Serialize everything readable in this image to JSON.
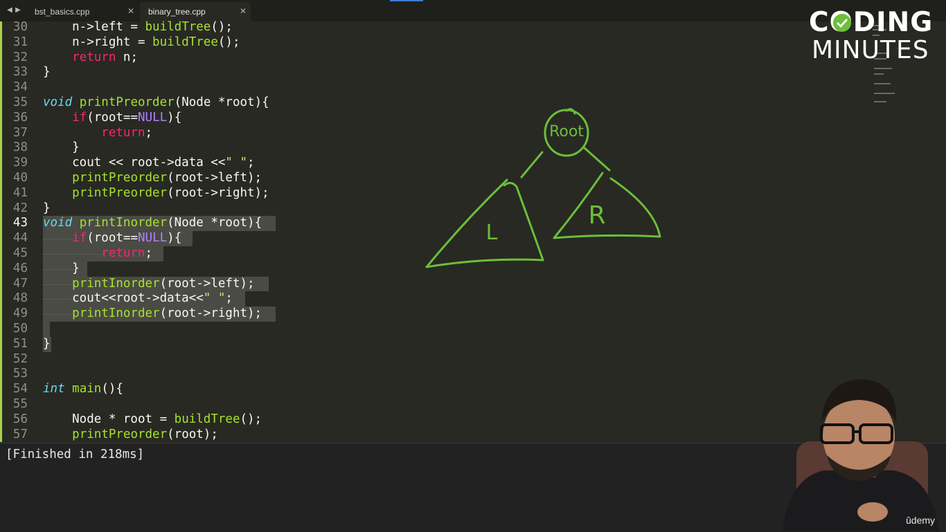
{
  "tabs": [
    {
      "label": "bst_basics.cpp",
      "active": false
    },
    {
      "label": "binary_tree.cpp",
      "active": true
    }
  ],
  "nav": {
    "back_icon": "◀",
    "forward_icon": "▶"
  },
  "lines": {
    "l30": {
      "n": "30",
      "a": "    n->left = ",
      "b": "buildTree",
      "c": "();"
    },
    "l31": {
      "n": "31",
      "a": "    n->right = ",
      "b": "buildTree",
      "c": "();"
    },
    "l32": {
      "n": "32",
      "a": "    ",
      "b": "return",
      "c": " n;"
    },
    "l33": {
      "n": "33",
      "a": "}"
    },
    "l34": {
      "n": "34"
    },
    "l35": {
      "n": "35",
      "t": "void",
      "sp": " ",
      "f": "printPreorder",
      "r": "(Node *root){"
    },
    "l36": {
      "n": "36",
      "a": "    ",
      "k": "if",
      "b": "(root==",
      "c": "NULL",
      "d": "){"
    },
    "l37": {
      "n": "37",
      "a": "        ",
      "k": "return",
      "b": ";"
    },
    "l38": {
      "n": "38",
      "a": "    }"
    },
    "l39": {
      "n": "39",
      "a": "    cout << root->data <<",
      "s": "\" \"",
      "b": ";"
    },
    "l40": {
      "n": "40",
      "a": "    ",
      "f": "printPreorder",
      "b": "(root->left);"
    },
    "l41": {
      "n": "41",
      "a": "    ",
      "f": "printPreorder",
      "b": "(root->right);"
    },
    "l42": {
      "n": "42",
      "a": "}"
    },
    "l43": {
      "n": "43",
      "t": "void",
      "sp": " ",
      "f": "printInorder",
      "r": "(Node *root){"
    },
    "l44": {
      "n": "44",
      "a": "    ",
      "k": "if",
      "b": "(root==",
      "c": "NULL",
      "d": "){"
    },
    "l45": {
      "n": "45",
      "a": "        ",
      "k": "return",
      "b": ";"
    },
    "l46": {
      "n": "46",
      "a": "    }"
    },
    "l47": {
      "n": "47",
      "a": "    ",
      "f": "printInorder",
      "b": "(root->left);"
    },
    "l48": {
      "n": "48",
      "a": "    cout<<root->data<<",
      "s": "\" \"",
      "b": ";"
    },
    "l49": {
      "n": "49",
      "a": "    ",
      "f": "printInorder",
      "b": "(root->right);"
    },
    "l50": {
      "n": "50"
    },
    "l51": {
      "n": "51",
      "a": "}"
    },
    "l52": {
      "n": "52"
    },
    "l53": {
      "n": "53"
    },
    "l54": {
      "n": "54",
      "t": "int",
      "sp": " ",
      "f": "main",
      "r": "(){"
    },
    "l55": {
      "n": "55"
    },
    "l56": {
      "n": "56",
      "a": "    Node * root = ",
      "f": "buildTree",
      "b": "();"
    },
    "l57": {
      "n": "57",
      "a": "    ",
      "f": "printPreorder",
      "b": "(root);"
    }
  },
  "console": {
    "output": "[Finished in 218ms]"
  },
  "logo": {
    "line1": "CODING",
    "line2": "MINUTES"
  },
  "drawing": {
    "root_label": "Root",
    "left_label": "L",
    "right_label": "R"
  },
  "watermark": {
    "text": "ûdemy"
  },
  "colors": {
    "annotation": "#6bbf3a",
    "keyword": "#f92672",
    "function": "#a6e22e",
    "type": "#66d9ef",
    "constant": "#ae81ff",
    "string": "#e6db74"
  }
}
